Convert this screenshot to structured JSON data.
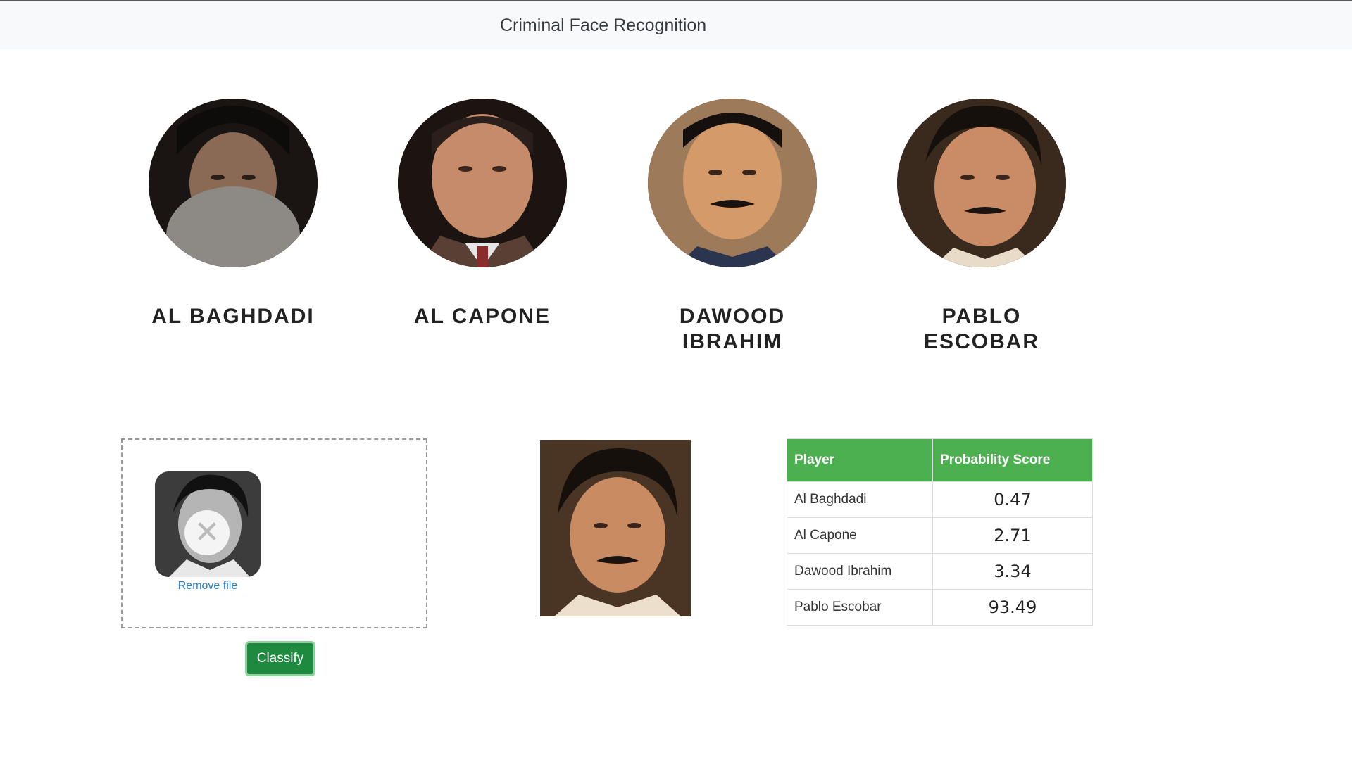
{
  "navbar": {
    "title": "Criminal Face Recognition"
  },
  "criminals": [
    {
      "name": "AL BAGHDADI"
    },
    {
      "name": "AL CAPONE"
    },
    {
      "name": "DAWOOD IBRAHIM"
    },
    {
      "name": "PABLO ESCOBAR"
    }
  ],
  "upload": {
    "remove_label": "Remove file",
    "remove_icon": "close-icon"
  },
  "classify_label": "Classify",
  "results": {
    "headers": {
      "player": "Player",
      "score": "Probability Score"
    },
    "rows": [
      {
        "player": "Al Baghdadi",
        "score": "0.47"
      },
      {
        "player": "Al Capone",
        "score": "2.71"
      },
      {
        "player": "Dawood Ibrahim",
        "score": "3.34"
      },
      {
        "player": "Pablo Escobar",
        "score": "93.49"
      }
    ]
  },
  "colors": {
    "navbar_bg": "#f8f9fa",
    "table_header": "#4caf50",
    "button": "#1e8a3f",
    "link": "#2a7dc9"
  }
}
